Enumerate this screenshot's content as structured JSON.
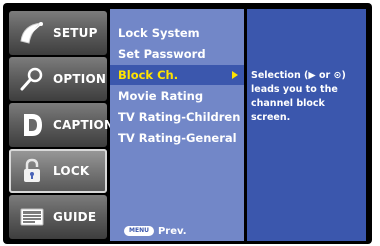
{
  "sidebar": {
    "items": [
      {
        "label": "SETUP",
        "icon": "satellite-dish-icon"
      },
      {
        "label": "OPTION",
        "icon": "magnifier-icon"
      },
      {
        "label": "CAPTION",
        "icon": "caption-d-icon"
      },
      {
        "label": "LOCK",
        "icon": "padlock-icon"
      },
      {
        "label": "GUIDE",
        "icon": "tv-guide-icon"
      }
    ],
    "active_index": 3
  },
  "submenu": {
    "items": [
      {
        "label": "Lock System"
      },
      {
        "label": "Set Password"
      },
      {
        "label": "Block Ch."
      },
      {
        "label": "Movie Rating"
      },
      {
        "label": "TV Rating-Children"
      },
      {
        "label": "TV Rating-General"
      }
    ],
    "selected_index": 2,
    "footer": {
      "badge": "MENU",
      "label": "Prev."
    }
  },
  "help": {
    "text": "Selection (▶ or ⊙)\nleads you to the\nchannel block screen."
  },
  "colors": {
    "submenu_bg": "#7287c8",
    "help_bg": "#3b57ad",
    "highlight_text": "#ffe300"
  }
}
